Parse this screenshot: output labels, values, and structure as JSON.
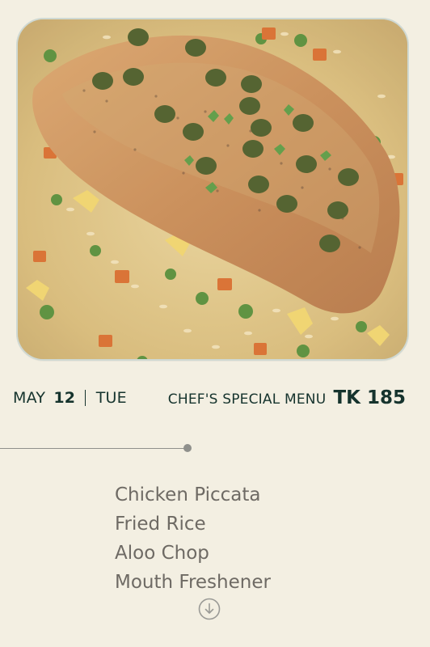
{
  "header": {
    "month": "MAY",
    "day": "12",
    "weekday": "TUE",
    "menu_label": "CHEF'S SPECIAL MENU",
    "price": "TK 185"
  },
  "photo": {
    "alt": "Chicken piccata served over fried rice with peas and carrots"
  },
  "menu": {
    "items": [
      "Chicken Piccata",
      "Fried Rice",
      "Aloo Chop",
      "Mouth Freshener"
    ]
  },
  "icons": {
    "scroll_down": "chevron-down-circle-icon"
  },
  "colors": {
    "background": "#f3efe2",
    "text_dark": "#15332d",
    "text_muted": "#6e6a64",
    "divider": "#8f908c",
    "card_border": "#cfd9d3"
  }
}
